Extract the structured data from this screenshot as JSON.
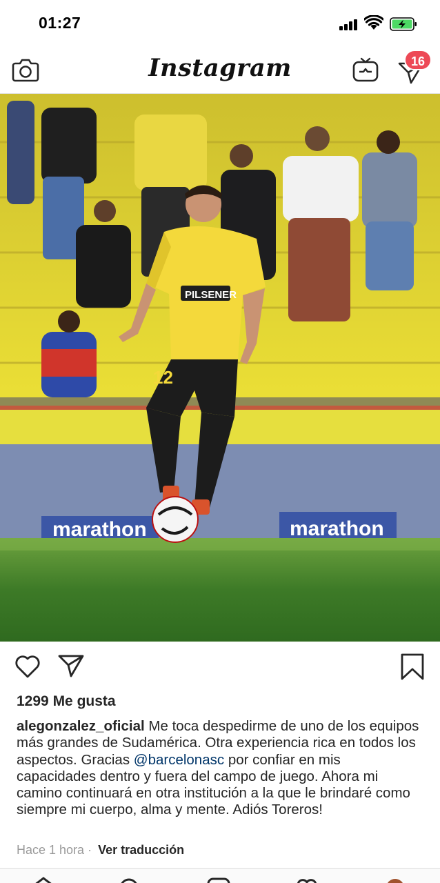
{
  "status_bar": {
    "time": "01:27"
  },
  "header": {
    "logo_text": "Instagram",
    "notification_count": "16"
  },
  "post": {
    "photo_signage": [
      "marathon",
      "marathon"
    ],
    "shirt_sponsor": "PILSENER",
    "shirt_number": "12",
    "likes": {
      "count": "1299",
      "label": "Me gusta"
    },
    "caption": {
      "username": "alegonzalez_oficial",
      "text_before_mention": " Me toca despedirme de uno de los equipos más grandes de Sudamérica. Otra experiencia rica en todos los aspectos. Gracias ",
      "mention": "@barcelonasc",
      "text_after_mention": " por confiar en mis capacidades dentro y fuera del campo de juego. Ahora mi camino continuará en otra institución a la que le brindaré como siempre mi cuerpo, alma y mente. Adiós Toreros!"
    },
    "timestamp": "Hace 1 hora",
    "separator": "·",
    "translate_label": "Ver traducción"
  },
  "colors": {
    "accent_red": "#ed4956",
    "mention_blue": "#003569",
    "battery_green": "#4cd964",
    "stadium_yellow": "#e8d231",
    "jersey_yellow": "#f4d93b",
    "grass_green": "#3f7f2a"
  },
  "icons": {
    "camera": "camera-icon",
    "igtv": "igtv-icon",
    "direct": "direct-icon",
    "like": "heart-icon",
    "share": "paper-plane-icon",
    "save": "bookmark-icon"
  }
}
